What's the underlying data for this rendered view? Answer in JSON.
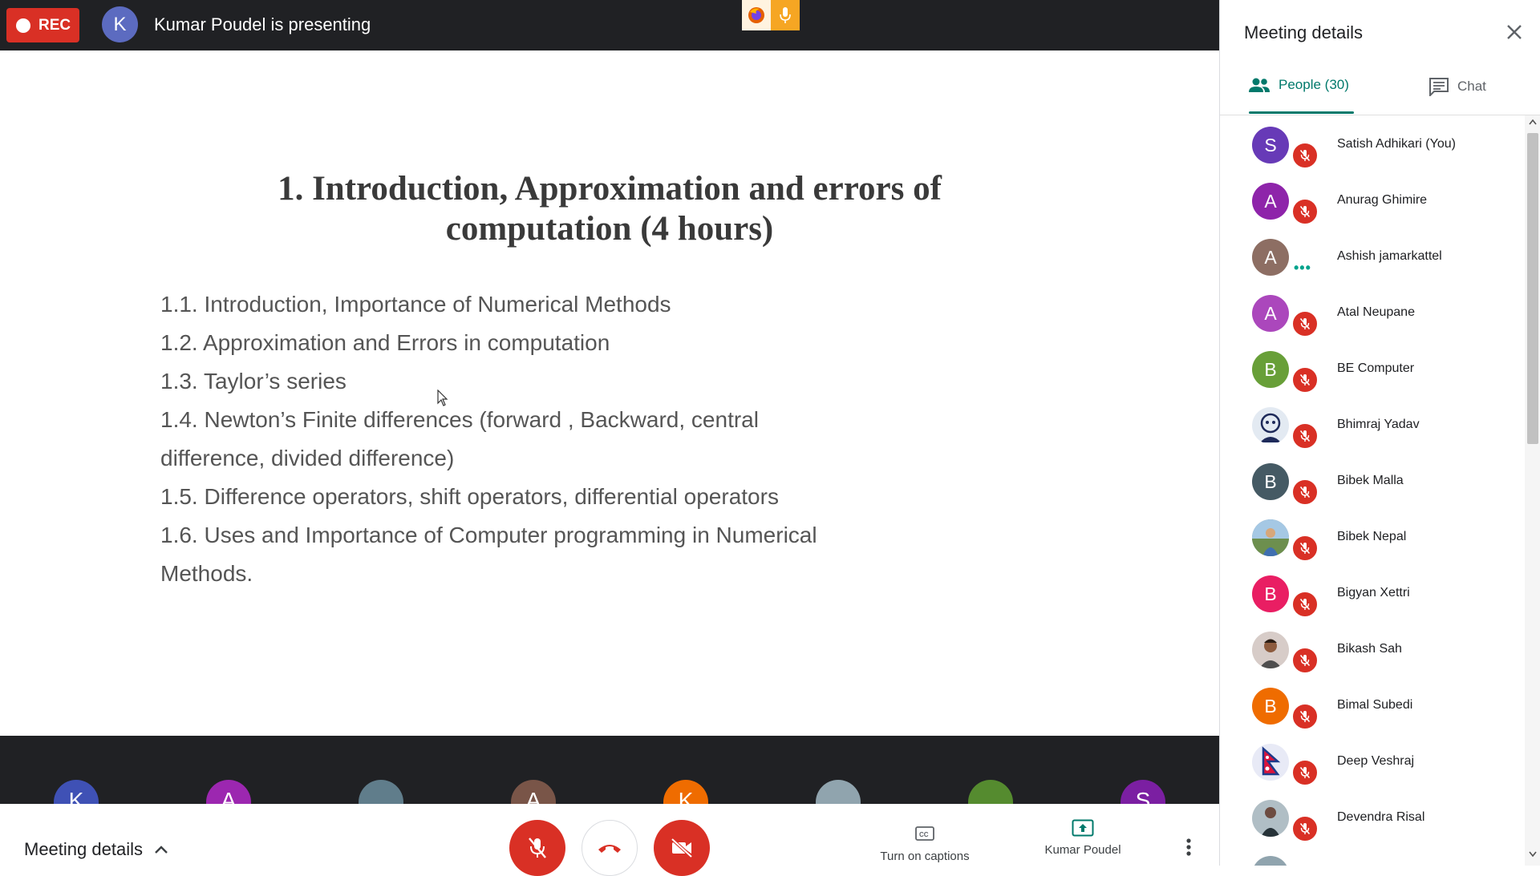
{
  "top_bar": {
    "rec_label": "REC",
    "presenter_initial": "K",
    "presenting_text": "Kumar Poudel is presenting"
  },
  "slide": {
    "title_line1": "1. Introduction, Approximation and errors of",
    "title_line2": "computation (4 hours)",
    "items": [
      "1.1. Introduction, Importance of Numerical Methods",
      "1.2. Approximation and Errors in computation",
      "1.3. Taylor’s series",
      "1.4. Newton’s Finite differences (forward , Backward, central",
      "difference, divided difference)",
      "1.5. Difference operators, shift operators, differential operators",
      "1.6. Uses and Importance of Computer programming in Numerical",
      "Methods."
    ]
  },
  "filmstrip": [
    {
      "initial": "K",
      "color": "#3f51b5"
    },
    {
      "initial": "A",
      "color": "#9c27b0"
    },
    {
      "initial": "",
      "color": "#607d8b"
    },
    {
      "initial": "A",
      "color": "#795548"
    },
    {
      "initial": "K",
      "color": "#ef6c00"
    },
    {
      "initial": "",
      "color": "#90a4ae"
    },
    {
      "initial": "",
      "color": "#558b2f"
    },
    {
      "initial": "S",
      "color": "#7b1fa2"
    }
  ],
  "bottom_bar": {
    "meeting_details_label": "Meeting details",
    "captions_label": "Turn on captions",
    "presenter_label": "Kumar Poudel"
  },
  "panel": {
    "title": "Meeting details",
    "people_tab": "People (30)",
    "chat_tab": "Chat",
    "participants": [
      {
        "name": "Satish Adhikari (You)",
        "initial": "S",
        "color": "#673ab7",
        "status": "muted"
      },
      {
        "name": "Anurag Ghimire",
        "initial": "A",
        "color": "#8e24aa",
        "status": "muted"
      },
      {
        "name": "Ashish jamarkattel",
        "initial": "A",
        "color": "#8d6e63",
        "status": "speaking"
      },
      {
        "name": "Atal Neupane",
        "initial": "A",
        "color": "#ab47bc",
        "status": "muted"
      },
      {
        "name": "BE Computer",
        "initial": "B",
        "color": "#689f38",
        "status": "muted"
      },
      {
        "name": "Bhimraj Yadav",
        "initial": "",
        "color": "#e3eaf2",
        "status": "muted"
      },
      {
        "name": "Bibek Malla",
        "initial": "B",
        "color": "#455a64",
        "status": "muted"
      },
      {
        "name": "Bibek Nepal",
        "initial": "",
        "color": "#78909c",
        "status": "muted"
      },
      {
        "name": "Bigyan Xettri",
        "initial": "B",
        "color": "#e91e63",
        "status": "muted"
      },
      {
        "name": "Bikash Sah",
        "initial": "",
        "color": "#a1887f",
        "status": "muted"
      },
      {
        "name": "Bimal Subedi",
        "initial": "B",
        "color": "#ef6c00",
        "status": "muted"
      },
      {
        "name": "Deep Veshraj",
        "initial": "",
        "color": "#1e3a8a",
        "status": "muted"
      },
      {
        "name": "Devendra Risal",
        "initial": "",
        "color": "#607d8b",
        "status": "muted"
      }
    ]
  }
}
